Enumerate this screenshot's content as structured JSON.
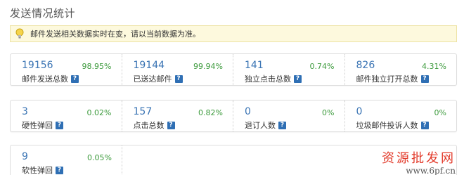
{
  "title": "发送情况统计",
  "notice": {
    "icon": "lightbulb-icon",
    "text": "邮件发送相关数据实时在变，请以当前数据为准。"
  },
  "rows": [
    [
      {
        "count": "19156",
        "percent": "98.95%",
        "label": "邮件发送总数"
      },
      {
        "count": "19144",
        "percent": "99.94%",
        "label": "已送达邮件"
      },
      {
        "count": "141",
        "percent": "0.74%",
        "label": "独立点击总数"
      },
      {
        "count": "826",
        "percent": "4.31%",
        "label": "邮件独立打开总数"
      }
    ],
    [
      {
        "count": "3",
        "percent": "0.02%",
        "label": "硬性弹回"
      },
      {
        "count": "157",
        "percent": "0.82%",
        "label": "点击总数"
      },
      {
        "count": "0",
        "percent": "0%",
        "label": "退订人数"
      },
      {
        "count": "0",
        "percent": "0%",
        "label": "垃圾邮件投诉人数"
      }
    ],
    [
      {
        "count": "9",
        "percent": "0.05%",
        "label": "软性弹回"
      }
    ]
  ],
  "help_symbol": "?",
  "watermark": {
    "title": "资源批发网",
    "subtitle": "www.6pf.cn"
  },
  "colors": {
    "count": "#3a74b4",
    "percent": "#3c9a3c",
    "notice_bg": "#fdf9dd",
    "help_icon": "#2f6fb4",
    "watermark": "#e23a2a"
  }
}
